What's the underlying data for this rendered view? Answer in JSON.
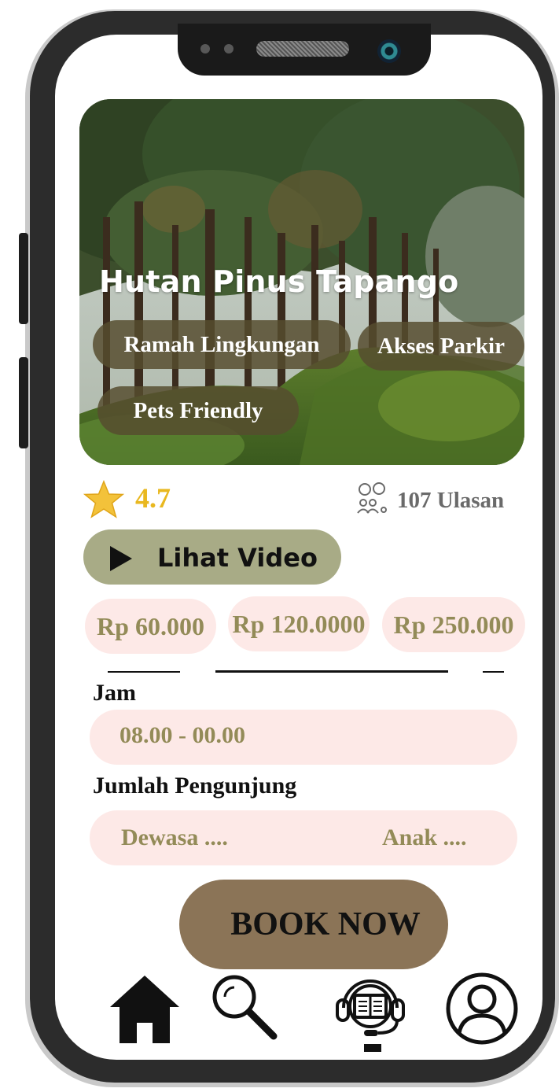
{
  "place": {
    "name": "Hutan Pinus Tapango",
    "tags": [
      "Ramah Lingkungan",
      "Akses Parkir",
      "Pets Friendly"
    ]
  },
  "rating": {
    "value": "4.7",
    "reviews_label": "107 Ulasan"
  },
  "video_button": {
    "label": "Lihat Video",
    "icon": "play-icon"
  },
  "prices": [
    "Rp 60.000",
    "Rp 120.0000",
    "Rp 250.000"
  ],
  "hours": {
    "label": "Jam",
    "value": "08.00 - 00.00"
  },
  "visitors": {
    "label": "Jumlah Pengunjung",
    "adult": "Dewasa ....",
    "child": "Anak ...."
  },
  "book_button": {
    "label": "BOOK NOW"
  },
  "bottom_nav": [
    {
      "name": "home",
      "icon": "home-icon"
    },
    {
      "name": "search",
      "icon": "search-icon"
    },
    {
      "name": "guide",
      "icon": "book-support-icon"
    },
    {
      "name": "profile",
      "icon": "user-icon"
    }
  ],
  "colors": {
    "accent_olive": "#a8ab86",
    "chip_pink": "#fde9e7",
    "price_text": "#938b58",
    "book_brown": "#8b7457",
    "star_yellow": "#f3c23a"
  }
}
